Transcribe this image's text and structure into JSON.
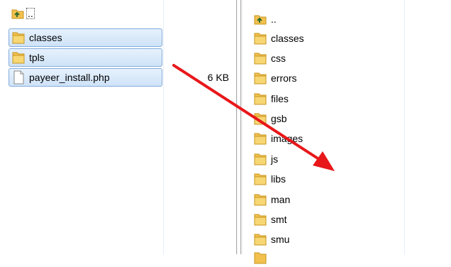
{
  "left_pane": {
    "parent_label": "..",
    "items": [
      {
        "name": "classes",
        "type": "folder",
        "size": ""
      },
      {
        "name": "tpls",
        "type": "folder",
        "size": ""
      },
      {
        "name": "payeer_install.php",
        "type": "file",
        "size": "6 KB"
      }
    ]
  },
  "right_pane": {
    "parent_label": "..",
    "items": [
      {
        "name": "classes"
      },
      {
        "name": "css"
      },
      {
        "name": "errors"
      },
      {
        "name": "files"
      },
      {
        "name": "gsb"
      },
      {
        "name": "images"
      },
      {
        "name": "js"
      },
      {
        "name": "libs"
      },
      {
        "name": "man"
      },
      {
        "name": "smt"
      },
      {
        "name": "smu"
      }
    ]
  },
  "colors": {
    "arrow": "#e8171a",
    "selection_border": "#84acdd",
    "folder": "#f2c14e"
  }
}
